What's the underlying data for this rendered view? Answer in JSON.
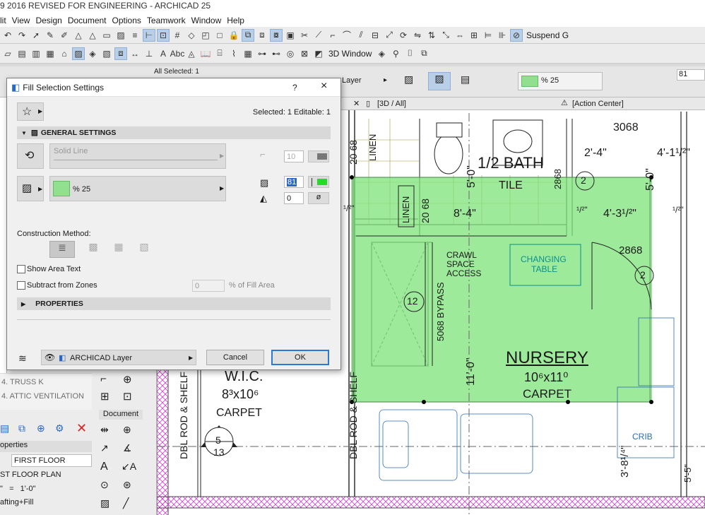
{
  "app": {
    "title": "9 2016  REVISED FOR ENGINEERING - ARCHICAD 25"
  },
  "menu": [
    "lit",
    "View",
    "Design",
    "Document",
    "Options",
    "Teamwork",
    "Window",
    "Help"
  ],
  "toolbar": {
    "suspend": "Suspend G",
    "window_3d": "3D Window"
  },
  "infobox": {
    "all_selected": "All Selected: 1",
    "layer": "Layer",
    "fill_pct": "% 25",
    "right_value": "81"
  },
  "tabs": {
    "view_3d": "[3D / All]",
    "action_center": "[Action Center]"
  },
  "dialog": {
    "title": "Fill Selection Settings",
    "help": "?",
    "close": "×",
    "selected_info": "Selected: 1 Editable: 1",
    "general_settings": "GENERAL SETTINGS",
    "line_type": "Solid Line",
    "pen_value": "10",
    "fill_name": "% 25",
    "fg_pen_value": "81",
    "bg_pen_value": "0",
    "construction_method": "Construction Method:",
    "show_area_text": "Show Area Text",
    "subtract_from_zones": "Subtract from Zones",
    "fill_area_value": "0",
    "fill_area_suffix": "% of Fill Area",
    "properties": "PROPERTIES",
    "layer": "ARCHICAD Layer",
    "cancel": "Cancel",
    "ok": "OK",
    "fg_color": "#22dd22"
  },
  "navigator": {
    "items": [
      "4. TRUSS K",
      "4. ATTIC VENTILATION"
    ],
    "document_label": "Document",
    "properties_label": "operties",
    "first_floor": "FIRST FLOOR",
    "first_floor_plan": "ST FLOOR PLAN",
    "scale": "\"   =   1'-0\"",
    "drafting": "afting+Fill"
  },
  "plan": {
    "bath": "1/2 BATH",
    "tile": "TILE",
    "linen": "LINEN",
    "changing": "CHANGING",
    "table": "TABLE",
    "crawl1": "CRAWL",
    "crawl2": "SPACE",
    "crawl3": "ACCESS",
    "bypass": "5068 BYPASS",
    "nursery": "NURSERY",
    "nursery_dim": "10⁶x11⁰",
    "carpet": "CARPET",
    "wic": "W.I.C.",
    "wic_dim": "8³x10⁶",
    "crib": "CRIB",
    "dbl_rod": "DBL ROD & SHELF",
    "d_3068": "3068",
    "d_2868a": "2868",
    "d_2868b": "2868",
    "d_2068": "20 68",
    "d_2068b": "20 68",
    "d_84": "8'-4\"",
    "d_43a": "4'-3¹/²\"",
    "d_24": "2'-4\"",
    "d_41": "4'-1¹/²\"",
    "d_110": "11'-0\"",
    "d_50": "5'-0\"",
    "d_38": "3'-8¹/⁴\"",
    "d_55": "5'-5\"",
    "tag_2": "2",
    "tag_12": "12",
    "sec_5": "5",
    "sec_13": "13",
    "frac": "¹/²\"",
    "fill_color": "#7ee37a"
  }
}
